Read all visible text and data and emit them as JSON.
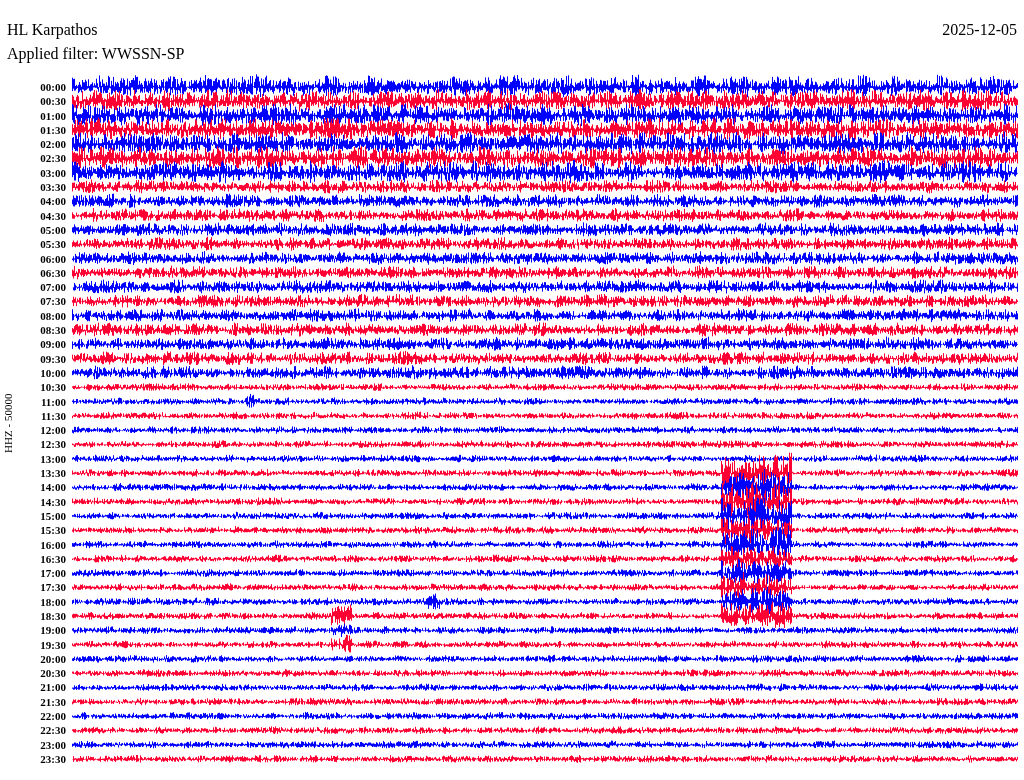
{
  "header": {
    "station": "HL Karpathos",
    "date": "2025-12-05",
    "filter": "Applied filter: WWSSN-SP"
  },
  "axis_label": "HHZ - 50000",
  "rows": [
    {
      "time": "00:00",
      "color": "#0000ff"
    },
    {
      "time": "00:30",
      "color": "#ff0033"
    },
    {
      "time": "01:00",
      "color": "#0000ff"
    },
    {
      "time": "01:30",
      "color": "#ff0033"
    },
    {
      "time": "02:00",
      "color": "#0000ff"
    },
    {
      "time": "02:30",
      "color": "#ff0033"
    },
    {
      "time": "03:00",
      "color": "#0000ff"
    },
    {
      "time": "03:30",
      "color": "#ff0033"
    },
    {
      "time": "04:00",
      "color": "#0000ff"
    },
    {
      "time": "04:30",
      "color": "#ff0033"
    },
    {
      "time": "05:00",
      "color": "#0000ff"
    },
    {
      "time": "05:30",
      "color": "#ff0033"
    },
    {
      "time": "06:00",
      "color": "#0000ff"
    },
    {
      "time": "06:30",
      "color": "#ff0033"
    },
    {
      "time": "07:00",
      "color": "#0000ff"
    },
    {
      "time": "07:30",
      "color": "#ff0033"
    },
    {
      "time": "08:00",
      "color": "#0000ff"
    },
    {
      "time": "08:30",
      "color": "#ff0033"
    },
    {
      "time": "09:00",
      "color": "#0000ff"
    },
    {
      "time": "09:30",
      "color": "#ff0033"
    },
    {
      "time": "10:00",
      "color": "#0000ff"
    },
    {
      "time": "10:30",
      "color": "#ff0033"
    },
    {
      "time": "11:00",
      "color": "#0000ff"
    },
    {
      "time": "11:30",
      "color": "#ff0033"
    },
    {
      "time": "12:00",
      "color": "#0000ff"
    },
    {
      "time": "12:30",
      "color": "#ff0033"
    },
    {
      "time": "13:00",
      "color": "#0000ff"
    },
    {
      "time": "13:30",
      "color": "#ff0033"
    },
    {
      "time": "14:00",
      "color": "#0000ff"
    },
    {
      "time": "14:30",
      "color": "#ff0033"
    },
    {
      "time": "15:00",
      "color": "#0000ff"
    },
    {
      "time": "15:30",
      "color": "#ff0033"
    },
    {
      "time": "16:00",
      "color": "#0000ff"
    },
    {
      "time": "16:30",
      "color": "#ff0033"
    },
    {
      "time": "17:00",
      "color": "#0000ff"
    },
    {
      "time": "17:30",
      "color": "#ff0033"
    },
    {
      "time": "18:00",
      "color": "#0000ff"
    },
    {
      "time": "18:30",
      "color": "#ff0033"
    },
    {
      "time": "19:00",
      "color": "#0000ff"
    },
    {
      "time": "19:30",
      "color": "#ff0033"
    },
    {
      "time": "20:00",
      "color": "#0000ff"
    },
    {
      "time": "20:30",
      "color": "#ff0033"
    },
    {
      "time": "21:00",
      "color": "#0000ff"
    },
    {
      "time": "21:30",
      "color": "#ff0033"
    },
    {
      "time": "22:00",
      "color": "#0000ff"
    },
    {
      "time": "22:30",
      "color": "#ff0033"
    },
    {
      "time": "23:00",
      "color": "#0000ff"
    },
    {
      "time": "23:30",
      "color": "#ff0033"
    }
  ]
}
